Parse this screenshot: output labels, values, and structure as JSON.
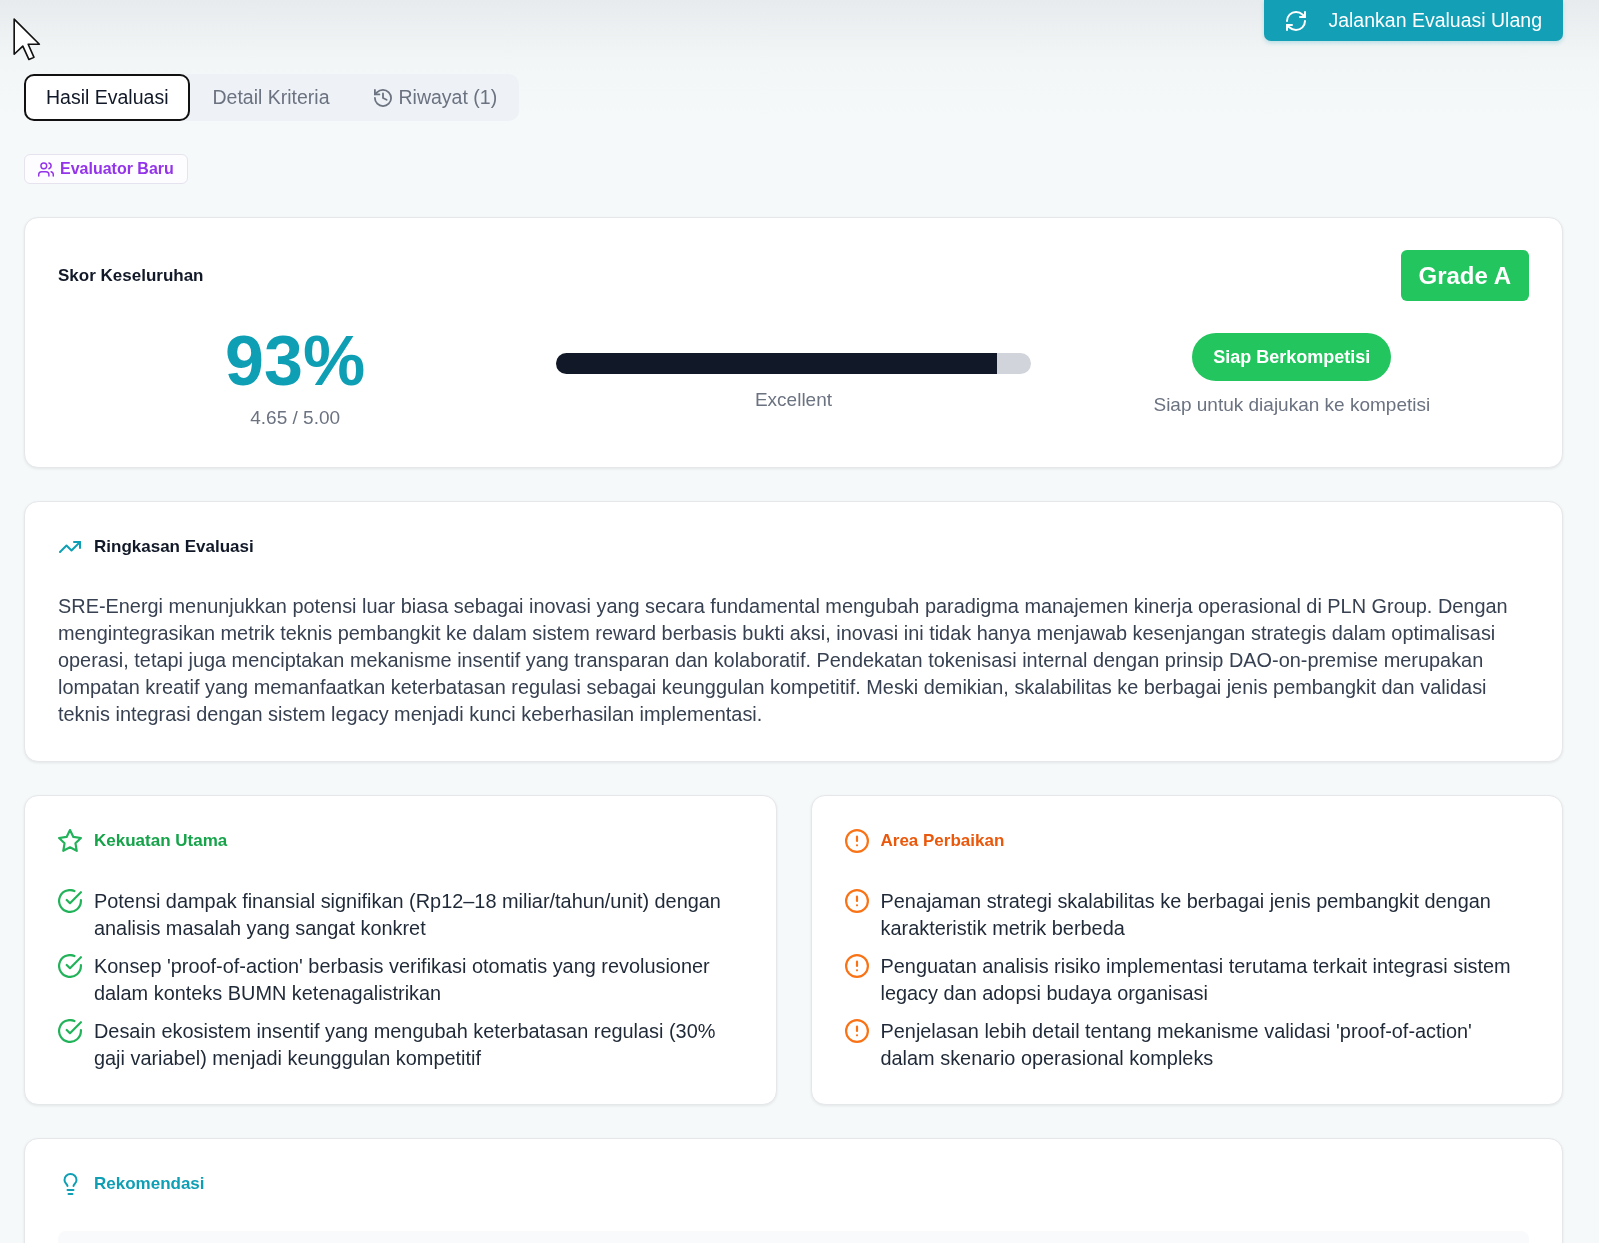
{
  "header": {
    "rerun_button": "Jalankan Evaluasi Ulang"
  },
  "tabs": [
    {
      "label": "Hasil Evaluasi",
      "selected": true,
      "kind": "plain"
    },
    {
      "label": "Detail Kriteria",
      "selected": false,
      "kind": "plain"
    },
    {
      "label": "Riwayat (1)",
      "selected": false,
      "kind": "history"
    }
  ],
  "evaluator_badge": "Evaluator Baru",
  "score_card": {
    "title": "Skor Keseluruhan",
    "grade": "Grade A",
    "percent": "93%",
    "score": "4.65 / 5.00",
    "level": 0.93,
    "rating": "Excellent",
    "status": "Siap Berkompetisi",
    "status_note": "Siap untuk diajukan ke kompetisi"
  },
  "summary": {
    "title": "Ringkasan Evaluasi",
    "text": "SRE-Energi menunjukkan potensi luar biasa sebagai inovasi yang secara fundamental mengubah paradigma manajemen kinerja operasional di PLN Group. Dengan mengintegrasikan metrik teknis pembangkit ke dalam sistem reward berbasis bukti aksi, inovasi ini tidak hanya menjawab kesenjangan strategis dalam optimalisasi operasi, tetapi juga menciptakan mekanisme insentif yang transparan dan kolaboratif. Pendekatan tokenisasi internal dengan prinsip DAO-on-premise merupakan lompatan kreatif yang memanfaatkan keterbatasan regulasi sebagai keunggulan kompetitif. Meski demikian, skalabilitas ke berbagai jenis pembangkit dan validasi teknis integrasi dengan sistem legacy menjadi kunci keberhasilan implementasi."
  },
  "strengths": {
    "title": "Kekuatan Utama",
    "items": [
      "Potensi dampak finansial signifikan (Rp12–18 miliar/tahun/unit) dengan analisis masalah yang sangat konkret",
      "Konsep 'proof-of-action' berbasis verifikasi otomatis yang revolusioner dalam konteks BUMN ketenagalistrikan",
      "Desain ekosistem insentif yang mengubah keterbatasan regulasi (30% gaji variabel) menjadi keunggulan kompetitif"
    ]
  },
  "improvements": {
    "title": "Area Perbaikan",
    "items": [
      "Penajaman strategi skalabilitas ke berbagai jenis pembangkit dengan karakteristik metrik berbeda",
      "Penguatan analisis risiko implementasi terutama terkait integrasi sistem legacy dan adopsi budaya organisasi",
      "Penjelasan lebih detail tentang mekanisme validasi 'proof-of-action' dalam skenario operasional kompleks"
    ]
  },
  "recommendations": {
    "title": "Rekomendasi"
  }
}
